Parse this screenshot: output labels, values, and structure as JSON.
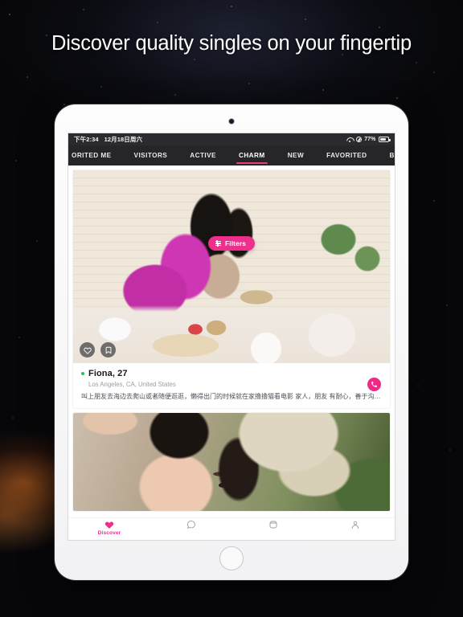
{
  "headline": "Discover quality singles on your fingertip",
  "device": {
    "type": "tablet",
    "frame_color": "#fafafa"
  },
  "statusbar": {
    "time": "下午2:34",
    "date": "12月18日周六",
    "battery_percent": "77%",
    "icons": [
      "wifi-icon",
      "location-icon",
      "battery-icon"
    ]
  },
  "tabs": [
    {
      "label": "ORITED ME",
      "active": false
    },
    {
      "label": "VISITORS",
      "active": false
    },
    {
      "label": "ACTIVE",
      "active": false
    },
    {
      "label": "CHARM",
      "active": true
    },
    {
      "label": "NEW",
      "active": false
    },
    {
      "label": "FAVORITED",
      "active": false
    },
    {
      "label": "BOOKMARK",
      "active": false
    }
  ],
  "colors": {
    "accent_pink": "#ef2f8c",
    "tab_underline": "#ea3d7e",
    "online_dot": "#26c165",
    "tabbar_bg": "#262629",
    "statusbar_bg": "#2b2b2f"
  },
  "cards": [
    {
      "photo_actions": [
        {
          "icon": "heart-icon"
        },
        {
          "icon": "bookmark-icon"
        }
      ],
      "online": true,
      "name": "Fiona, 27",
      "location": "Los Angeles, CA, United States",
      "bio": "叫上朋友去海边去爬山或者随便逛逛，懒得出门的时候就在家撸撸猫看电影 家人，朋友 有耐心，善于沟通…",
      "call_icon": "phone-icon"
    },
    {
      "filters_label": "Filters",
      "filters_icon": "sliders-icon"
    }
  ],
  "bottomnav": [
    {
      "icon": "heart-icon",
      "label": "Discover",
      "active": true
    },
    {
      "icon": "chat-icon",
      "label": "",
      "active": false
    },
    {
      "icon": "moments-icon",
      "label": "",
      "active": false
    },
    {
      "icon": "profile-icon",
      "label": "",
      "active": false
    }
  ]
}
